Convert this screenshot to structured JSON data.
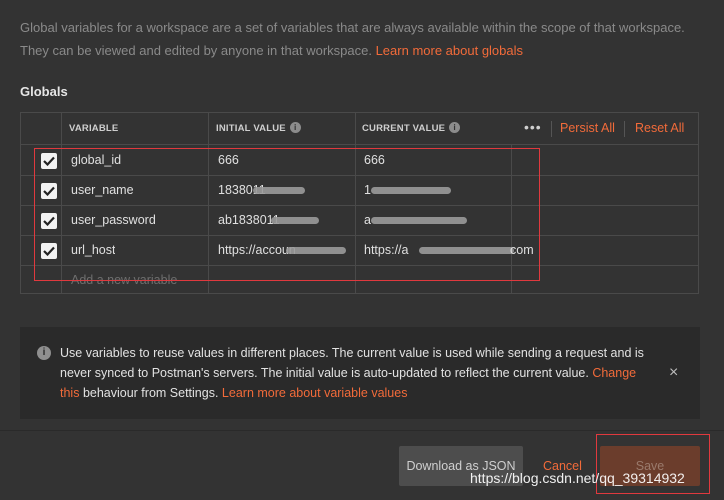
{
  "intro": {
    "text": "Global variables for a workspace are a set of variables that are always available within the scope of that workspace. They can be viewed and edited by anyone in that workspace.",
    "link": "Learn more about globals"
  },
  "globals_title": "Globals",
  "table": {
    "headers": {
      "variable": "VARIABLE",
      "initial": "INITIAL VALUE",
      "current": "CURRENT VALUE"
    },
    "more_label": "•••",
    "persist_all": "Persist All",
    "reset_all": "Reset All",
    "rows": [
      {
        "checked": true,
        "variable": "global_id",
        "initial": "666",
        "current": "666"
      },
      {
        "checked": true,
        "variable": "user_name",
        "initial": "1838011",
        "current": "1"
      },
      {
        "checked": true,
        "variable": "user_password",
        "initial": "ab1838011",
        "current": "a"
      },
      {
        "checked": true,
        "variable": "url_host",
        "initial": "https://accoun",
        "current": "https://a"
      }
    ],
    "row4_current_suffix": "com",
    "add_placeholder": "Add a new variable"
  },
  "notice": {
    "text": "Use variables to reuse values in different places. The current value is used while sending a request and is never synced to Postman's servers. The initial value is auto-updated to reflect the current value.",
    "link1": "Change this",
    "text2": "behaviour from Settings.",
    "link2": "Learn more about variable values",
    "close": "×"
  },
  "footer": {
    "download": "Download as JSON",
    "cancel": "Cancel",
    "save": "Save"
  },
  "watermark": "https://blog.csdn.net/qq_39314932",
  "colors": {
    "accent": "#f26b3a",
    "background": "#333333",
    "highlight_box": "#e0393e"
  }
}
